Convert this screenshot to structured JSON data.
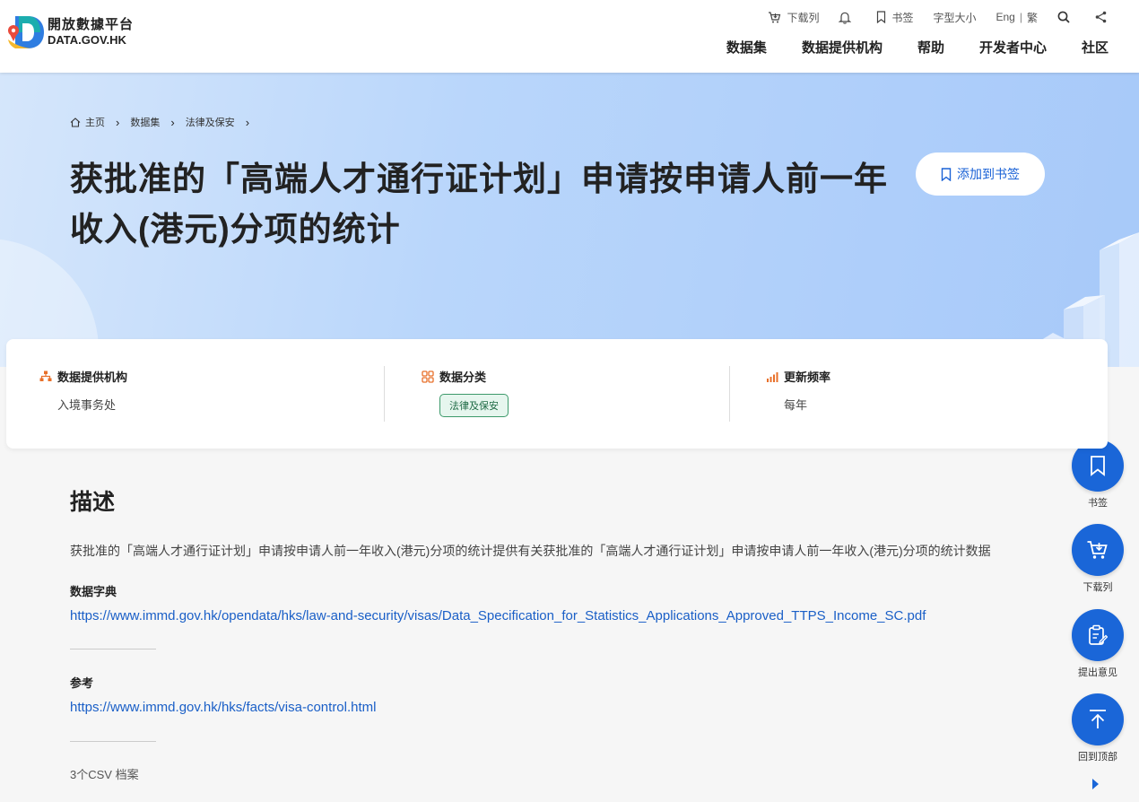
{
  "header": {
    "logo_cn": "開放數據平台",
    "logo_en": "DATA.GOV.HK",
    "util": {
      "download_list": "下载列",
      "bookmark": "书签",
      "font_size": "字型大小",
      "lang_en": "Eng",
      "lang_sep": "|",
      "lang_tc": "繁"
    },
    "nav": [
      "数据集",
      "数据提供机构",
      "帮助",
      "开发者中心",
      "社区"
    ]
  },
  "hero": {
    "breadcrumb": {
      "home": "主页",
      "datasets": "数据集",
      "category": "法律及保安"
    },
    "title": "获批准的「高端人才通行证计划」申请按申请人前一年收入(港元)分项的统计",
    "bookmark_button": "添加到书签"
  },
  "info": {
    "provider_label": "数据提供机构",
    "provider_value": "入境事务处",
    "category_label": "数据分类",
    "category_value": "法律及保安",
    "frequency_label": "更新频率",
    "frequency_value": "每年"
  },
  "content": {
    "description_title": "描述",
    "description": "获批准的「高端人才通行证计划」申请按申请人前一年收入(港元)分项的统计提供有关获批准的「高端人才通行证计划」申请按申请人前一年收入(港元)分项的统计数据",
    "dictionary_label": "数据字典",
    "dictionary_link": "https://www.immd.gov.hk/opendata/hks/law-and-security/visas/Data_Specification_for_Statistics_Applications_Approved_TTPS_Income_SC.pdf",
    "reference_label": "参考",
    "reference_link": "https://www.immd.gov.hk/hks/facts/visa-control.html",
    "csv_count": "3个CSV 档案"
  },
  "fabs": {
    "bookmark": "书签",
    "download": "下载列",
    "feedback": "提出意见",
    "top": "回到顶部"
  },
  "colors": {
    "accent": "#1a66d8",
    "link": "#1a5fc7",
    "tag_green": "#3d9a6b"
  }
}
